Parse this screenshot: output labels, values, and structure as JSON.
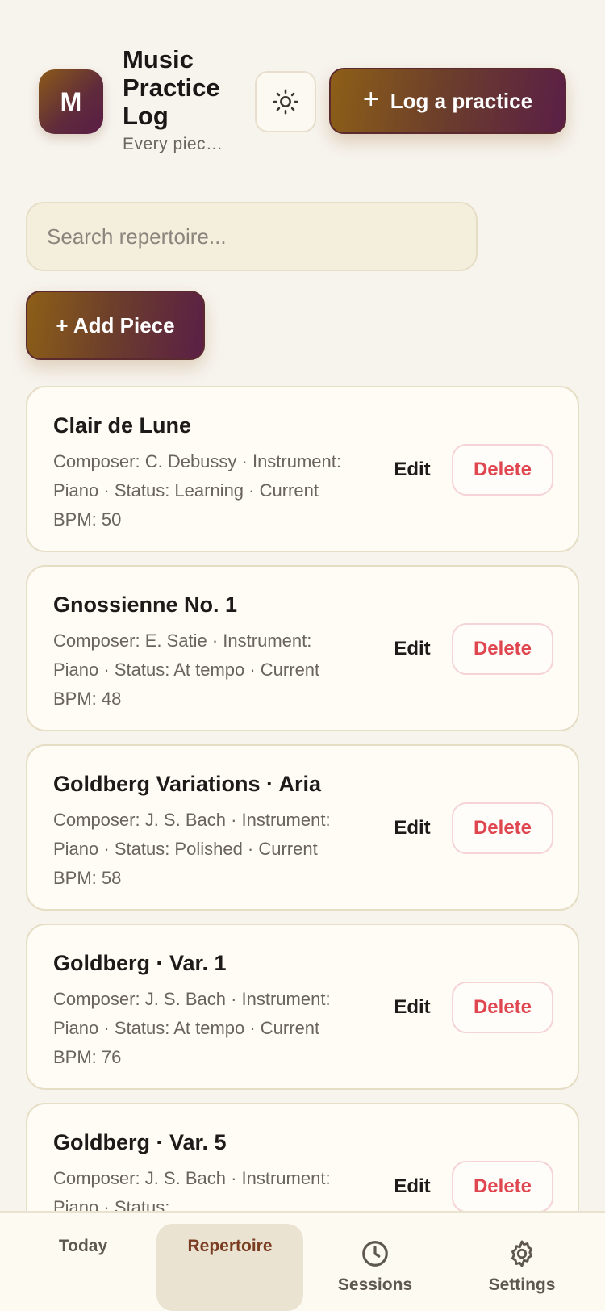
{
  "header": {
    "avatar_letter": "M",
    "title": "Music Practice Log",
    "subtitle": "Every piec…",
    "theme_icon": "sun-icon",
    "log_button_label": "Log a practice"
  },
  "search": {
    "placeholder": "Search repertoire...",
    "value": ""
  },
  "add_piece_label": "+ Add Piece",
  "pieces": [
    {
      "title": "Clair de Lune",
      "meta": "Composer: C. Debussy · Instrument: Piano · Status: Learning · Current BPM: 50",
      "edit_label": "Edit",
      "delete_label": "Delete"
    },
    {
      "title": "Gnossienne No. 1",
      "meta": "Composer: E. Satie · Instrument: Piano · Status: At tempo · Current BPM: 48",
      "edit_label": "Edit",
      "delete_label": "Delete"
    },
    {
      "title": "Goldberg Variations · Aria",
      "meta": "Composer: J. S. Bach · Instrument: Piano · Status: Polished · Current BPM: 58",
      "edit_label": "Edit",
      "delete_label": "Delete"
    },
    {
      "title": "Goldberg · Var. 1",
      "meta": "Composer: J. S. Bach · Instrument: Piano · Status: At tempo · Current BPM: 76",
      "edit_label": "Edit",
      "delete_label": "Delete"
    },
    {
      "title": "Goldberg · Var. 5",
      "meta": "Composer: J. S. Bach · Instrument: Piano · Status:",
      "edit_label": "Edit",
      "delete_label": "Delete"
    }
  ],
  "nav": {
    "today": "Today",
    "repertoire": "Repertoire",
    "sessions": "Sessions",
    "settings": "Settings",
    "active": "repertoire"
  },
  "colors": {
    "background": "#f7f4ee",
    "accent_gradient_start": "#8d5f17",
    "accent_gradient_end": "#5b1f46",
    "delete_red": "#e04650",
    "active_nav_bg": "#ebe3d1"
  }
}
